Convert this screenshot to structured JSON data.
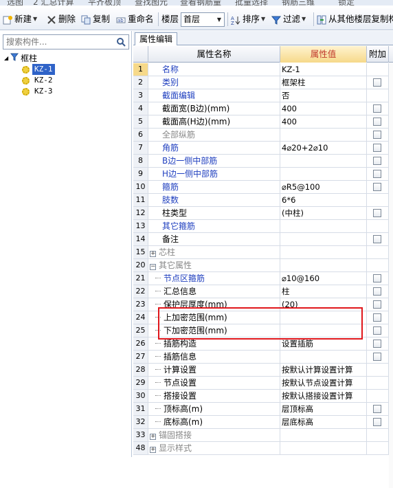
{
  "top_strip": [
    "选图",
    "2 汇总计算",
    "平齐板顶",
    "查找图元",
    "查看钢筋量",
    "批量选择",
    "钢筋三维",
    "锁定"
  ],
  "toolbar": {
    "new_label": "新建",
    "delete_label": "删除",
    "copy_label": "复制",
    "rename_label": "重命名",
    "floor_label": "楼层",
    "floor_value": "首层",
    "sort_label": "排序",
    "filter_label": "过滤",
    "copy_from_floor_label": "从其他楼层复制构件"
  },
  "left": {
    "search_placeholder": "搜索构件...",
    "tree": {
      "root": "框柱",
      "children": [
        "KZ-1",
        "KZ-2",
        "KZ-3"
      ],
      "selected": "KZ-1"
    }
  },
  "right": {
    "tab": "属性编辑",
    "columns": {
      "name": "属性名称",
      "value": "属性值",
      "extra": "附加"
    },
    "rows": [
      {
        "num": "1",
        "name": "名称",
        "value": "KZ-1",
        "style": "blue",
        "indent": 0,
        "checkbox": false
      },
      {
        "num": "2",
        "name": "类别",
        "value": "框架柱",
        "style": "blue",
        "indent": 0,
        "checkbox": true
      },
      {
        "num": "3",
        "name": "截面编辑",
        "value": "否",
        "style": "blue",
        "indent": 0,
        "checkbox": false
      },
      {
        "num": "4",
        "name": "截面宽(B边)(mm)",
        "value": "400",
        "style": "normal",
        "indent": 0,
        "checkbox": true
      },
      {
        "num": "5",
        "name": "截面高(H边)(mm)",
        "value": "400",
        "style": "normal",
        "indent": 0,
        "checkbox": true
      },
      {
        "num": "6",
        "name": "全部纵筋",
        "value": "",
        "style": "gray",
        "indent": 0,
        "checkbox": true
      },
      {
        "num": "7",
        "name": "角筋",
        "value": "4⌀20+2⌀10",
        "style": "blue",
        "indent": 0,
        "checkbox": true
      },
      {
        "num": "8",
        "name": "B边一侧中部筋",
        "value": "",
        "style": "blue",
        "indent": 0,
        "checkbox": true
      },
      {
        "num": "9",
        "name": "H边一侧中部筋",
        "value": "",
        "style": "blue",
        "indent": 0,
        "checkbox": true
      },
      {
        "num": "10",
        "name": "箍筋",
        "value": "⌀R5@100",
        "style": "blue",
        "indent": 0,
        "checkbox": true
      },
      {
        "num": "11",
        "name": "肢数",
        "value": "6*6",
        "style": "blue",
        "indent": 0,
        "checkbox": false
      },
      {
        "num": "12",
        "name": "柱类型",
        "value": "(中柱)",
        "style": "normal",
        "indent": 0,
        "checkbox": true
      },
      {
        "num": "13",
        "name": "其它箍筋",
        "value": "",
        "style": "blue",
        "indent": 0,
        "checkbox": false
      },
      {
        "num": "14",
        "name": "备注",
        "value": "",
        "style": "normal",
        "indent": 0,
        "checkbox": true
      },
      {
        "num": "15",
        "name": "芯柱",
        "value": "",
        "style": "gray",
        "indent": 0,
        "expander": "+",
        "checkbox": false
      },
      {
        "num": "20",
        "name": "其它属性",
        "value": "",
        "style": "gray",
        "indent": 0,
        "expander": "−",
        "checkbox": false
      },
      {
        "num": "21",
        "name": "节点区箍筋",
        "value": "⌀10@160",
        "style": "blue",
        "indent": 1,
        "checkbox": true
      },
      {
        "num": "22",
        "name": "汇总信息",
        "value": "柱",
        "style": "normal",
        "indent": 1,
        "checkbox": true
      },
      {
        "num": "23",
        "name": "保护层厚度(mm)",
        "value": "(20)",
        "style": "normal",
        "indent": 1,
        "checkbox": true
      },
      {
        "num": "24",
        "name": "上加密范围(mm)",
        "value": "",
        "style": "normal",
        "indent": 1,
        "checkbox": true
      },
      {
        "num": "25",
        "name": "下加密范围(mm)",
        "value": "",
        "style": "normal",
        "indent": 1,
        "checkbox": true
      },
      {
        "num": "26",
        "name": "插筋构造",
        "value": "设置插筋",
        "style": "normal",
        "indent": 1,
        "checkbox": true
      },
      {
        "num": "27",
        "name": "插筋信息",
        "value": "",
        "style": "normal",
        "indent": 1,
        "checkbox": true
      },
      {
        "num": "28",
        "name": "计算设置",
        "value": "按默认计算设置计算",
        "style": "normal",
        "indent": 1,
        "checkbox": false
      },
      {
        "num": "29",
        "name": "节点设置",
        "value": "按默认节点设置计算",
        "style": "normal",
        "indent": 1,
        "checkbox": false
      },
      {
        "num": "30",
        "name": "搭接设置",
        "value": "按默认搭接设置计算",
        "style": "normal",
        "indent": 1,
        "checkbox": false
      },
      {
        "num": "31",
        "name": "顶标高(m)",
        "value": "层顶标高",
        "style": "normal",
        "indent": 1,
        "checkbox": true
      },
      {
        "num": "32",
        "name": "底标高(m)",
        "value": "层底标高",
        "style": "normal",
        "indent": 1,
        "checkbox": true
      },
      {
        "num": "33",
        "name": "锚固搭接",
        "value": "",
        "style": "gray",
        "indent": 0,
        "expander": "+",
        "checkbox": false
      },
      {
        "num": "48",
        "name": "显示样式",
        "value": "",
        "style": "gray",
        "indent": 0,
        "expander": "+",
        "checkbox": false
      }
    ]
  }
}
